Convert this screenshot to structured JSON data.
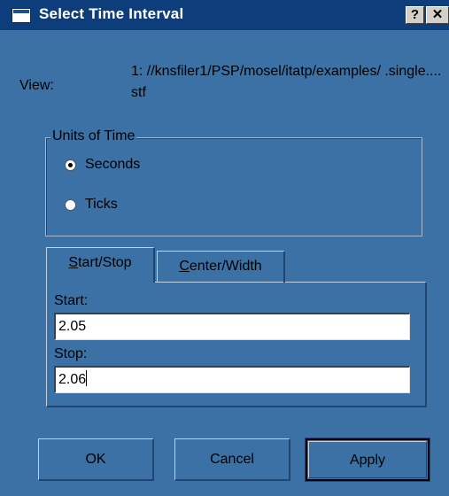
{
  "window": {
    "title": "Select Time Interval",
    "help_glyph": "?",
    "close_glyph": "✕"
  },
  "view": {
    "label": "View:",
    "value": "1: //knsfiler1/PSP/mosel/itatp/examples/ .single.... stf"
  },
  "units": {
    "legend": "Units of Time",
    "options": [
      {
        "label": "Seconds",
        "selected": true
      },
      {
        "label": "Ticks",
        "selected": false
      }
    ]
  },
  "tabs": [
    {
      "label": "Start/Stop",
      "accelerator": "S",
      "rest": "tart/Stop",
      "active": true
    },
    {
      "label": "Center/Width",
      "accelerator": "C",
      "rest": "enter/Width",
      "active": false
    }
  ],
  "fields": {
    "start_label": "Start:",
    "start_value": "2.05",
    "stop_label": "Stop:",
    "stop_value": "2.06"
  },
  "buttons": {
    "ok": "OK",
    "cancel": "Cancel",
    "apply": "Apply"
  },
  "colors": {
    "dialog_bg": "#3b71a4",
    "titlebar_bg": "#0d3e7b",
    "field_bg": "#ffffff"
  }
}
